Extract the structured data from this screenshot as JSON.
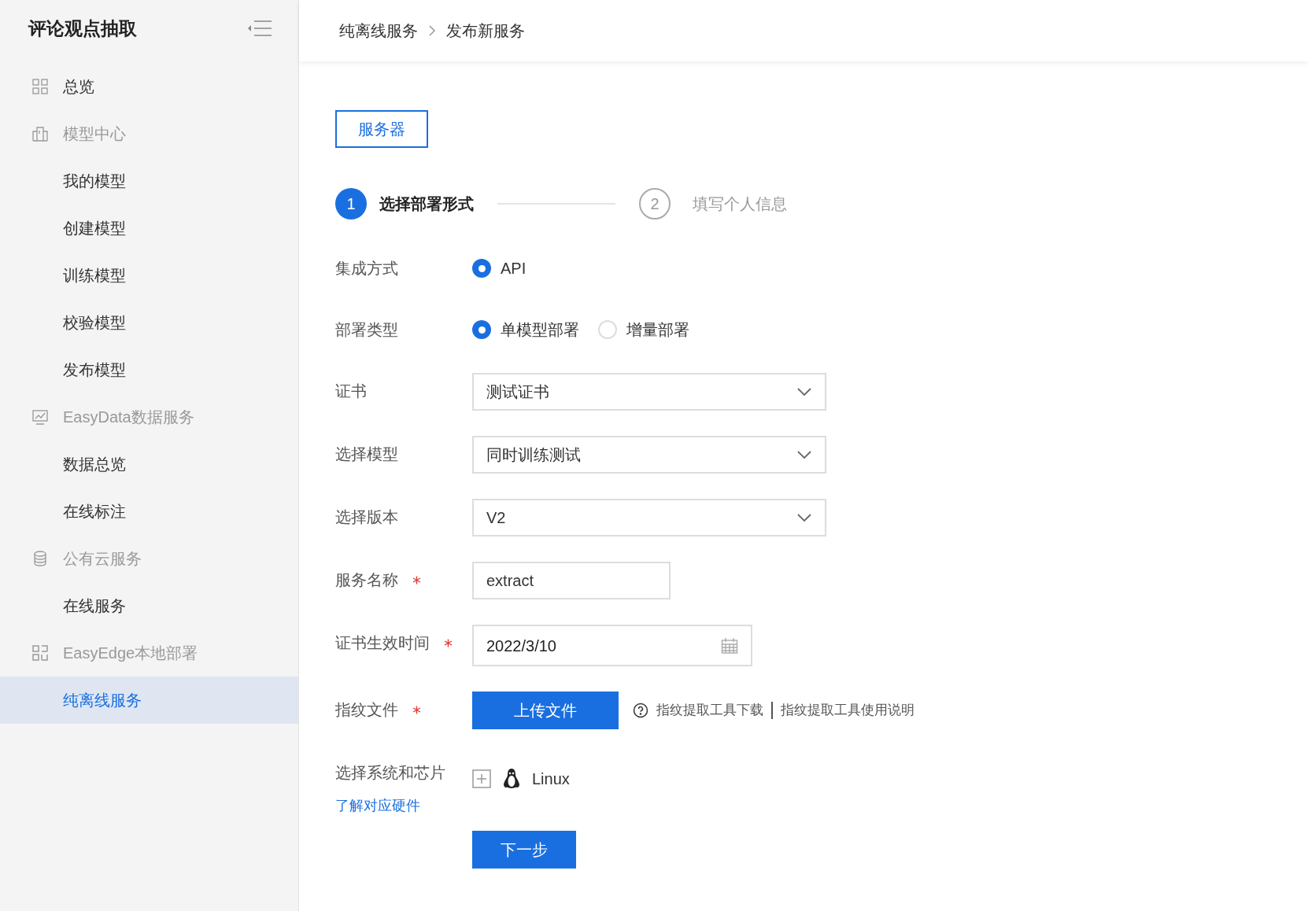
{
  "sidebar": {
    "title": "评论观点抽取",
    "items": [
      {
        "kind": "link",
        "label": "总览",
        "selected": false
      },
      {
        "kind": "group",
        "label": "模型中心",
        "children": [
          {
            "label": "我的模型",
            "selected": false
          },
          {
            "label": "创建模型",
            "selected": false
          },
          {
            "label": "训练模型",
            "selected": false
          },
          {
            "label": "校验模型",
            "selected": false
          },
          {
            "label": "发布模型",
            "selected": false
          }
        ]
      },
      {
        "kind": "group",
        "label": "EasyData数据服务",
        "children": [
          {
            "label": "数据总览",
            "selected": false
          },
          {
            "label": "在线标注",
            "selected": false
          }
        ]
      },
      {
        "kind": "group",
        "label": "公有云服务",
        "children": [
          {
            "label": "在线服务",
            "selected": false
          }
        ]
      },
      {
        "kind": "group",
        "label": "EasyEdge本地部署",
        "children": [
          {
            "label": "纯离线服务",
            "selected": true
          }
        ]
      }
    ]
  },
  "breadcrumb": [
    "纯离线服务",
    "发布新服务"
  ],
  "tabs": [
    {
      "label": "服务器",
      "selected": true
    }
  ],
  "steps": [
    {
      "number": "1",
      "label": "选择部署形式",
      "active": true
    },
    {
      "number": "2",
      "label": "填写个人信息",
      "active": false
    }
  ],
  "form": [
    {
      "kind": "radio",
      "label": "集成方式",
      "required": false,
      "options": [
        {
          "label": "API",
          "selected": true
        }
      ]
    },
    {
      "kind": "radio",
      "label": "部署类型",
      "required": false,
      "options": [
        {
          "label": "单模型部署",
          "selected": true
        },
        {
          "label": "增量部署",
          "selected": false
        }
      ]
    },
    {
      "kind": "select",
      "label": "证书",
      "required": false,
      "value": "测试证书"
    },
    {
      "kind": "select",
      "label": "选择模型",
      "required": false,
      "value": "同时训练测试"
    },
    {
      "kind": "select",
      "label": "选择版本",
      "required": false,
      "value": "V2"
    },
    {
      "kind": "input",
      "label": "服务名称",
      "required": true,
      "value": "extract"
    },
    {
      "kind": "date",
      "label": "证书生效时间",
      "required": true,
      "value": "2022/3/10"
    },
    {
      "kind": "upload",
      "label": "指纹文件",
      "required": true,
      "button": "上传文件",
      "links": [
        "指纹提取工具下载",
        "指纹提取工具使用说明"
      ]
    },
    {
      "kind": "system",
      "label": "选择系统和芯片",
      "required": false,
      "option": "Linux",
      "link": "了解对应硬件"
    }
  ],
  "next_button": "下一步"
}
